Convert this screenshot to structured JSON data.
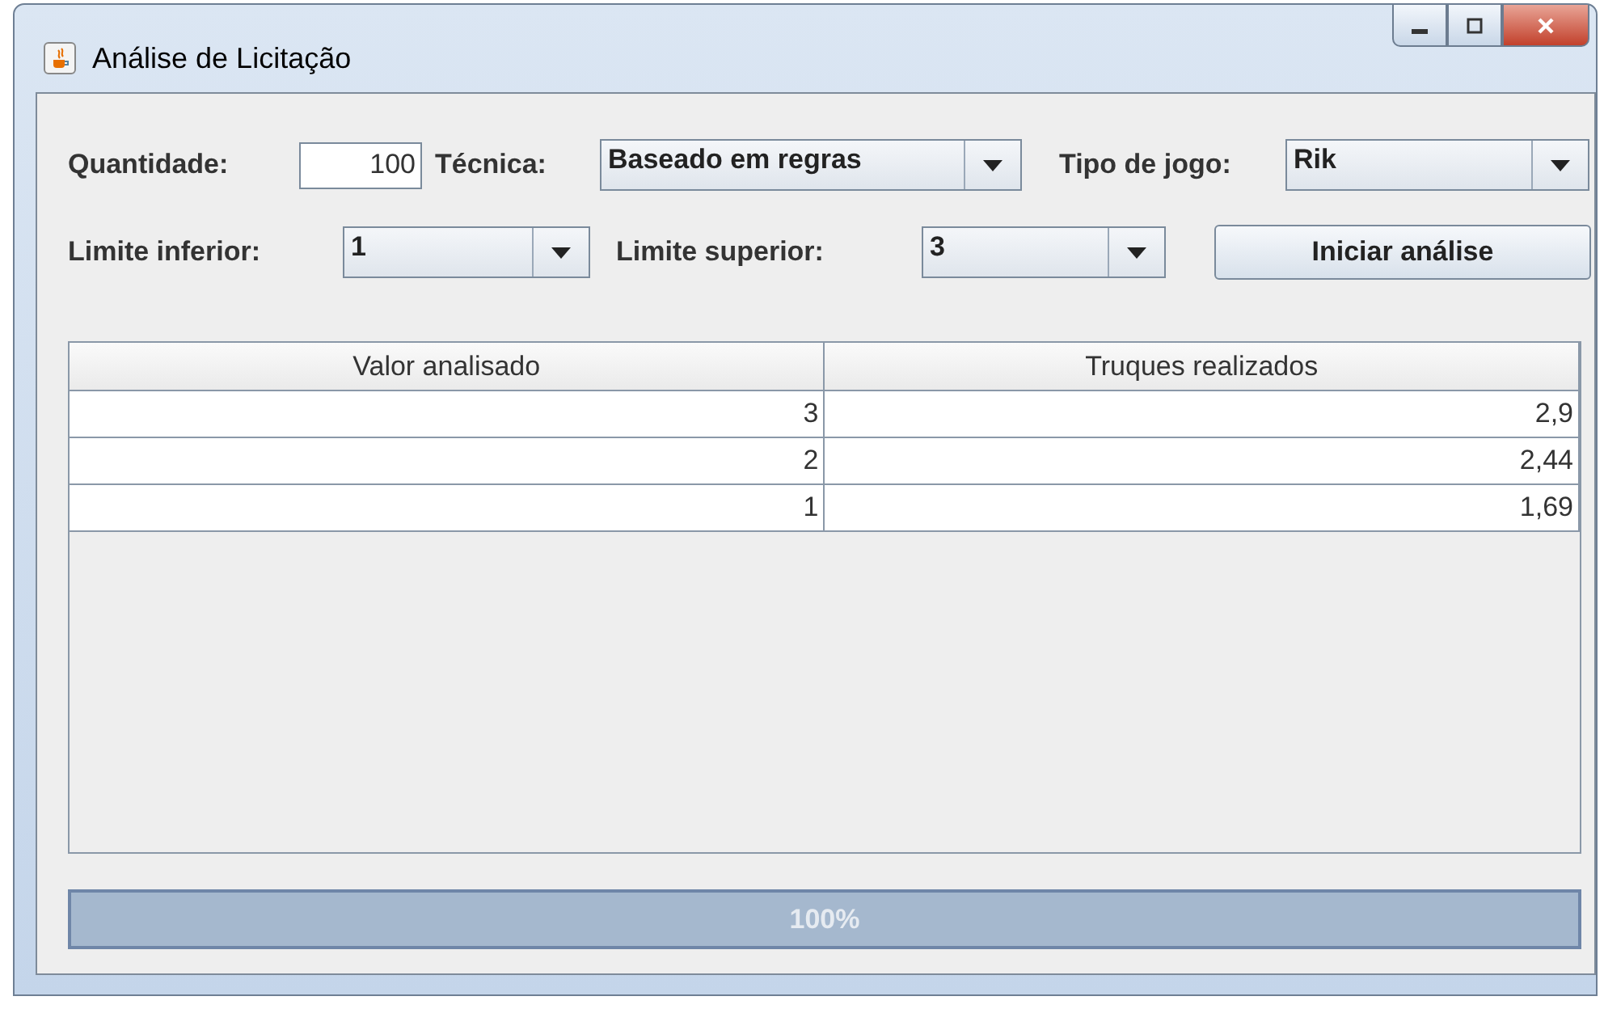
{
  "window": {
    "title": "Análise de Licitação"
  },
  "form": {
    "quantity": {
      "label": "Quantidade:",
      "value": "100"
    },
    "technique": {
      "label": "Técnica:",
      "value": "Baseado em regras"
    },
    "game_type": {
      "label": "Tipo de jogo:",
      "value": "Rik"
    },
    "lower_limit": {
      "label": "Limite inferior:",
      "value": "1"
    },
    "upper_limit": {
      "label": "Limite superior:",
      "value": "3"
    },
    "start_button": "Iniciar análise"
  },
  "table": {
    "columns": [
      "Valor analisado",
      "Truques realizados"
    ],
    "rows": [
      [
        "3",
        "2,9"
      ],
      [
        "2",
        "2,44"
      ],
      [
        "1",
        "1,69"
      ]
    ]
  },
  "progress": {
    "level": 1,
    "reading": "100%"
  }
}
